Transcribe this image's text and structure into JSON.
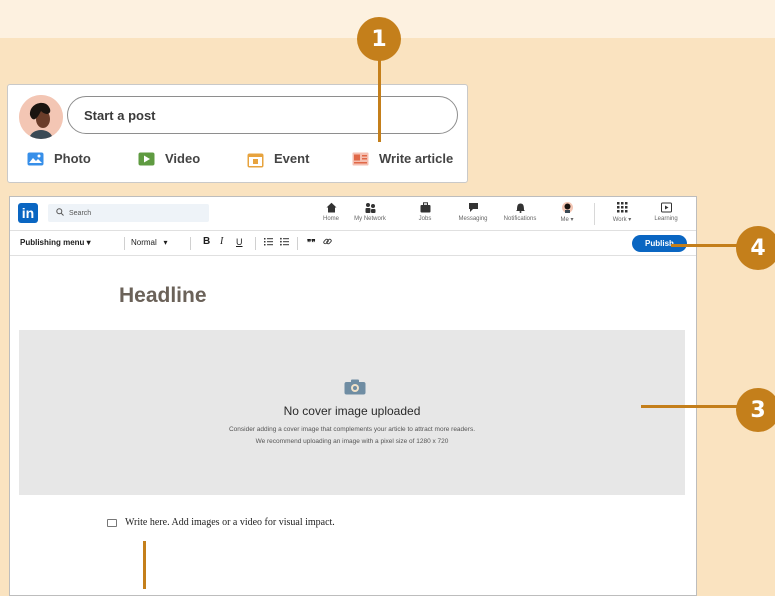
{
  "callouts": {
    "one": "1",
    "three": "3",
    "four": "4"
  },
  "post_box": {
    "placeholder": "Start a post",
    "actions": [
      {
        "label": "Photo",
        "icon": "photo-icon",
        "color": "#378fe9"
      },
      {
        "label": "Video",
        "icon": "video-icon",
        "color": "#5f9b41"
      },
      {
        "label": "Event",
        "icon": "calendar-icon",
        "color": "#c37d16"
      },
      {
        "label": "Write article",
        "icon": "article-icon",
        "color": "#e06847"
      }
    ]
  },
  "navbar": {
    "logo": "in",
    "search_placeholder": "Search",
    "items": [
      {
        "label": "Home",
        "icon": "home-icon"
      },
      {
        "label": "My Network",
        "icon": "network-icon"
      },
      {
        "label": "Jobs",
        "icon": "briefcase-icon"
      },
      {
        "label": "Messaging",
        "icon": "messaging-icon"
      },
      {
        "label": "Notifications",
        "icon": "bell-icon"
      },
      {
        "label": "Me",
        "icon": "avatar-icon"
      },
      {
        "label": "Work",
        "icon": "grid-icon"
      },
      {
        "label": "Learning",
        "icon": "play-icon"
      }
    ]
  },
  "toolbar": {
    "publishing_menu": "Publishing menu",
    "style_select": "Normal",
    "bold": "B",
    "italic": "I",
    "underline": "U",
    "quote": "❞❞",
    "link": "🔗",
    "publish": "Publish"
  },
  "editor": {
    "headline_placeholder": "Headline",
    "cover": {
      "title": "No cover image uploaded",
      "line1": "Consider adding a cover image that complements your article to attract more readers.",
      "line2": "We recommend uploading an image with a pixel size of 1280 x 720"
    },
    "body_placeholder": "Write here. Add images or a video for visual impact."
  },
  "colors": {
    "accent": "#c47f1b",
    "brand": "#0a66c2",
    "background": "#fae3c0"
  }
}
